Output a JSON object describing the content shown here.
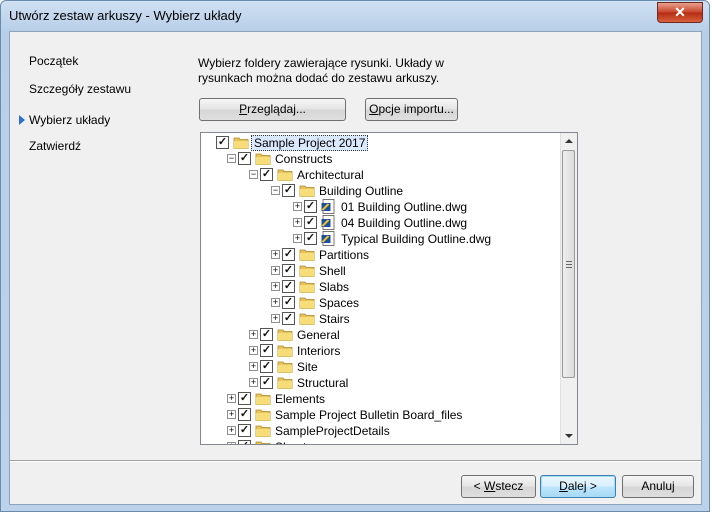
{
  "window": {
    "title": "Utwórz zestaw arkuszy - Wybierz układy",
    "close_glyph": "✕"
  },
  "nav": {
    "items": [
      "Początek",
      "Szczegóły zestawu",
      "Wybierz układy",
      "Zatwierdź"
    ],
    "active_index": 2
  },
  "description": "Wybierz foldery zawierające rysunki. Układy w rysunkach można dodać do zestawu arkuszy.",
  "buttons": {
    "browse": {
      "pre": "",
      "accel": "P",
      "post": "rzeglądaj..."
    },
    "import": {
      "pre": "",
      "accel": "O",
      "post": "pcje importu..."
    },
    "back": {
      "pre": "< ",
      "accel": "W",
      "post": "stecz"
    },
    "next": {
      "pre": "",
      "accel": "D",
      "post": "alej >"
    },
    "cancel": {
      "label": "Anuluj"
    }
  },
  "tree": {
    "check_glyph": "✓",
    "nodes": [
      {
        "label": "Sample Project 2017",
        "level": 0,
        "type": "folder",
        "expander": "",
        "checked": true,
        "selected": true
      },
      {
        "label": "Constructs",
        "level": 1,
        "type": "folder",
        "expander": "−",
        "checked": true
      },
      {
        "label": "Architectural",
        "level": 2,
        "type": "folder",
        "expander": "−",
        "checked": true
      },
      {
        "label": "Building Outline",
        "level": 3,
        "type": "folder",
        "expander": "−",
        "checked": true
      },
      {
        "label": "01 Building Outline.dwg",
        "level": 4,
        "type": "dwg",
        "expander": "+",
        "checked": true
      },
      {
        "label": "04 Building Outline.dwg",
        "level": 4,
        "type": "dwg",
        "expander": "+",
        "checked": true
      },
      {
        "label": "Typical Building Outline.dwg",
        "level": 4,
        "type": "dwg",
        "expander": "+",
        "checked": true
      },
      {
        "label": "Partitions",
        "level": 3,
        "type": "folder",
        "expander": "+",
        "checked": true
      },
      {
        "label": "Shell",
        "level": 3,
        "type": "folder",
        "expander": "+",
        "checked": true
      },
      {
        "label": "Slabs",
        "level": 3,
        "type": "folder",
        "expander": "+",
        "checked": true
      },
      {
        "label": "Spaces",
        "level": 3,
        "type": "folder",
        "expander": "+",
        "checked": true
      },
      {
        "label": "Stairs",
        "level": 3,
        "type": "folder",
        "expander": "+",
        "checked": true
      },
      {
        "label": "General",
        "level": 2,
        "type": "folder",
        "expander": "+",
        "checked": true
      },
      {
        "label": "Interiors",
        "level": 2,
        "type": "folder",
        "expander": "+",
        "checked": true
      },
      {
        "label": "Site",
        "level": 2,
        "type": "folder",
        "expander": "+",
        "checked": true
      },
      {
        "label": "Structural",
        "level": 2,
        "type": "folder",
        "expander": "+",
        "checked": true
      },
      {
        "label": "Elements",
        "level": 1,
        "type": "folder",
        "expander": "+",
        "checked": true
      },
      {
        "label": "Sample Project Bulletin Board_files",
        "level": 1,
        "type": "folder",
        "expander": "+",
        "checked": true
      },
      {
        "label": "SampleProjectDetails",
        "level": 1,
        "type": "folder",
        "expander": "+",
        "checked": true
      },
      {
        "label": "Sheets",
        "level": 1,
        "type": "folder",
        "expander": "+",
        "checked": true
      }
    ]
  },
  "colors": {
    "accent": "#2b6fd1",
    "selection": "#dbe9ff"
  }
}
